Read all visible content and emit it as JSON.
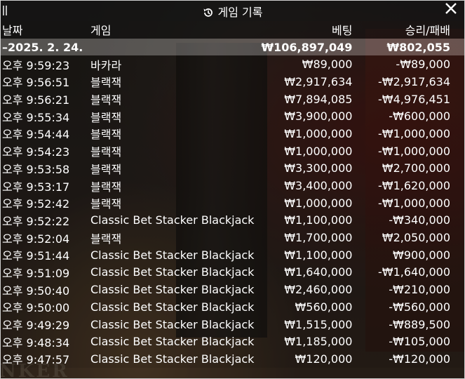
{
  "window": {
    "title": "게임 기록",
    "close_icon": "close-icon",
    "history_icon": "history-icon"
  },
  "table": {
    "headers": {
      "date": "날짜",
      "game": "게임",
      "bet": "베팅",
      "result": "승리/패배"
    },
    "summary": {
      "date": "–2025. 2. 24.",
      "game": "",
      "bet": "₩106,897,049",
      "result": "₩802,055"
    },
    "rows": [
      {
        "time": "오후 9:59:23",
        "game": "바카라",
        "bet": "₩89,000",
        "result": "-₩89,000"
      },
      {
        "time": "오후 9:56:51",
        "game": "블랙잭",
        "bet": "₩2,917,634",
        "result": "-₩2,917,634"
      },
      {
        "time": "오후 9:56:21",
        "game": "블랙잭",
        "bet": "₩7,894,085",
        "result": "-₩4,976,451"
      },
      {
        "time": "오후 9:55:34",
        "game": "블랙잭",
        "bet": "₩3,900,000",
        "result": "-₩600,000"
      },
      {
        "time": "오후 9:54:44",
        "game": "블랙잭",
        "bet": "₩1,000,000",
        "result": "-₩1,000,000"
      },
      {
        "time": "오후 9:54:23",
        "game": "블랙잭",
        "bet": "₩1,000,000",
        "result": "-₩1,000,000"
      },
      {
        "time": "오후 9:53:58",
        "game": "블랙잭",
        "bet": "₩3,300,000",
        "result": "₩2,700,000"
      },
      {
        "time": "오후 9:53:17",
        "game": "블랙잭",
        "bet": "₩3,400,000",
        "result": "-₩1,620,000"
      },
      {
        "time": "오후 9:52:42",
        "game": "블랙잭",
        "bet": "₩1,000,000",
        "result": "-₩1,000,000"
      },
      {
        "time": "오후 9:52:22",
        "game": "Classic Bet Stacker Blackjack",
        "bet": "₩1,100,000",
        "result": "-₩340,000"
      },
      {
        "time": "오후 9:52:04",
        "game": "블랙잭",
        "bet": "₩1,700,000",
        "result": "₩2,050,000"
      },
      {
        "time": "오후 9:51:44",
        "game": "Classic Bet Stacker Blackjack",
        "bet": "₩1,100,000",
        "result": "₩900,000"
      },
      {
        "time": "오후 9:51:09",
        "game": "Classic Bet Stacker Blackjack",
        "bet": "₩1,640,000",
        "result": "-₩1,640,000"
      },
      {
        "time": "오후 9:50:40",
        "game": "Classic Bet Stacker Blackjack",
        "bet": "₩2,460,000",
        "result": "-₩210,000"
      },
      {
        "time": "오후 9:50:00",
        "game": "Classic Bet Stacker Blackjack",
        "bet": "₩560,000",
        "result": "-₩560,000"
      },
      {
        "time": "오후 9:49:29",
        "game": "Classic Bet Stacker Blackjack",
        "bet": "₩1,515,000",
        "result": "-₩889,500"
      },
      {
        "time": "오후 9:48:34",
        "game": "Classic Bet Stacker Blackjack",
        "bet": "₩1,185,000",
        "result": "-₩105,000"
      },
      {
        "time": "오후 9:47:57",
        "game": "Classic Bet Stacker Blackjack",
        "bet": "₩120,000",
        "result": "-₩120,000"
      }
    ]
  },
  "background": {
    "partial_text": "NKER"
  }
}
